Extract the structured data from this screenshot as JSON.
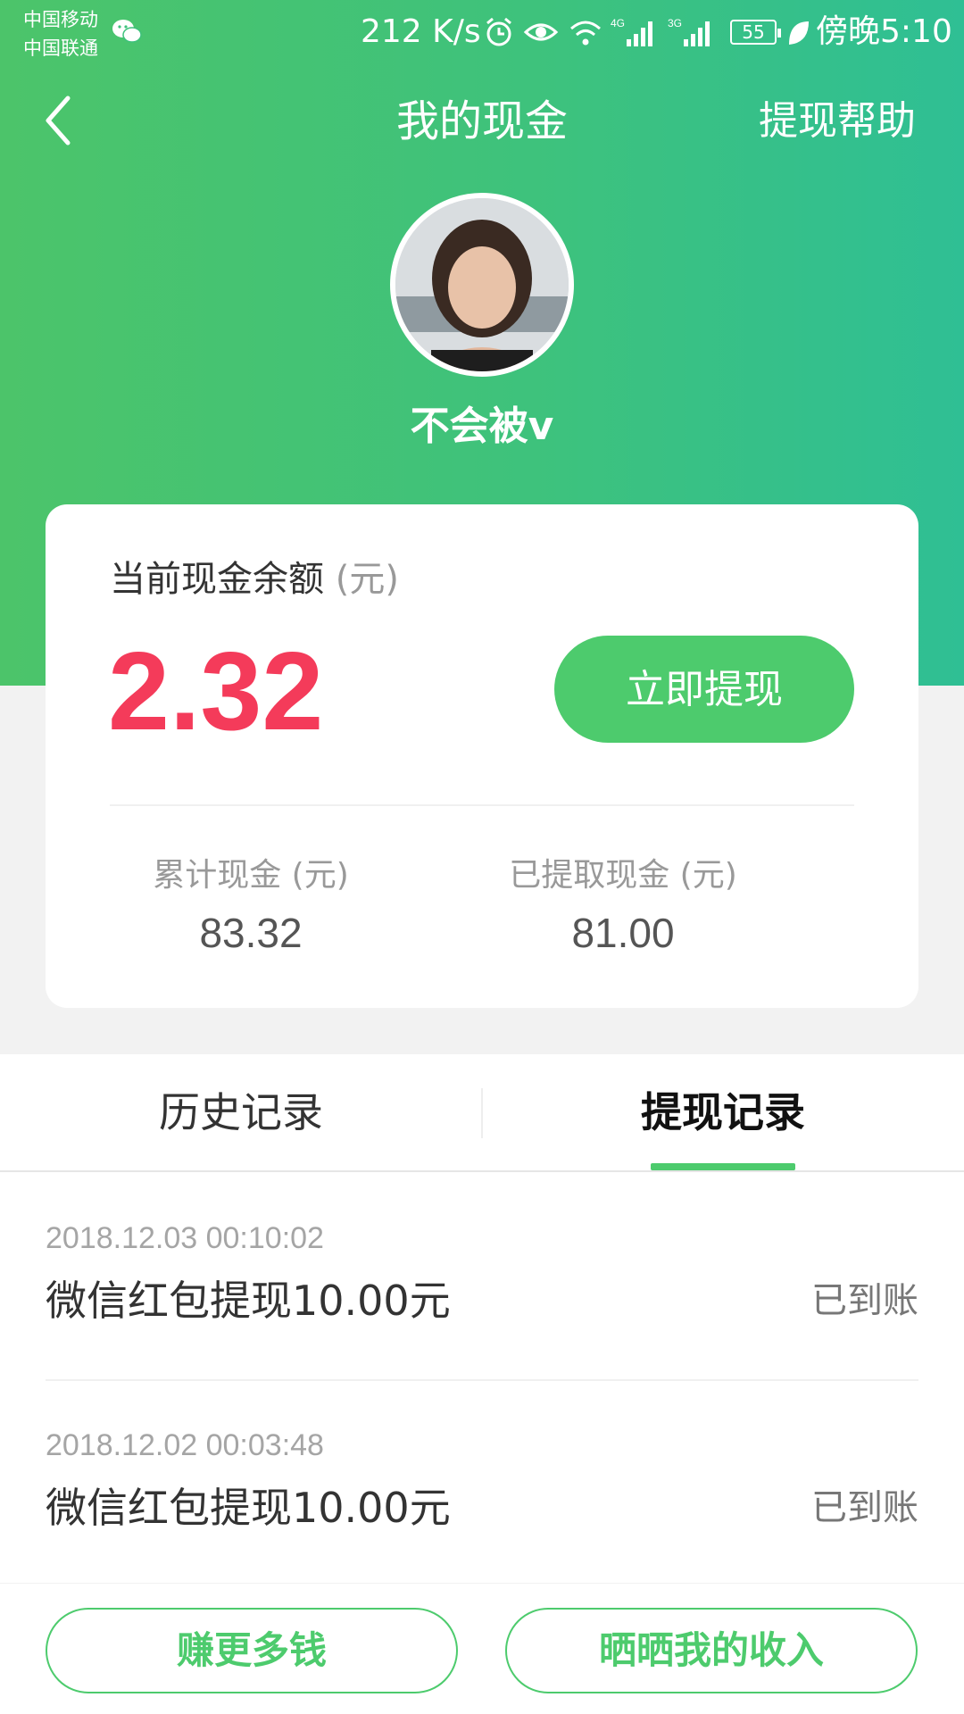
{
  "status_bar": {
    "carrier_1": "中国移动",
    "carrier_2": "中国联通",
    "net_speed": "212 K/s",
    "network_1": "4G",
    "network_2": "3G",
    "battery": "55",
    "time": "傍晚5:10",
    "icons": [
      "wechat-icon",
      "alarm-icon",
      "eye-icon",
      "wifi-icon",
      "signal-icon",
      "signal-icon",
      "battery-icon",
      "leaf-icon"
    ]
  },
  "nav": {
    "title": "我的现金",
    "help": "提现帮助",
    "back_icon": "back-chevron-icon"
  },
  "profile": {
    "username": "不会被v"
  },
  "balance": {
    "label": "当前现金余额",
    "unit": "(元)",
    "value": "2.32",
    "withdraw_button": "立即提现"
  },
  "stats": [
    {
      "label": "累计现金 (元)",
      "value": "83.32"
    },
    {
      "label": "已提取现金 (元)",
      "value": "81.00"
    }
  ],
  "tabs": [
    {
      "label": "历史记录",
      "active": false
    },
    {
      "label": "提现记录",
      "active": true
    }
  ],
  "records": [
    {
      "time": "2018.12.03 00:10:02",
      "title": "微信红包提现10.00元",
      "status": "已到账"
    },
    {
      "time": "2018.12.02 00:03:48",
      "title": "微信红包提现10.00元",
      "status": "已到账"
    }
  ],
  "bottom": {
    "earn_more": "赚更多钱",
    "share_income": "晒晒我的收入"
  },
  "colors": {
    "brand_green": "#4dcb6d",
    "balance_red": "#f43b5a"
  }
}
